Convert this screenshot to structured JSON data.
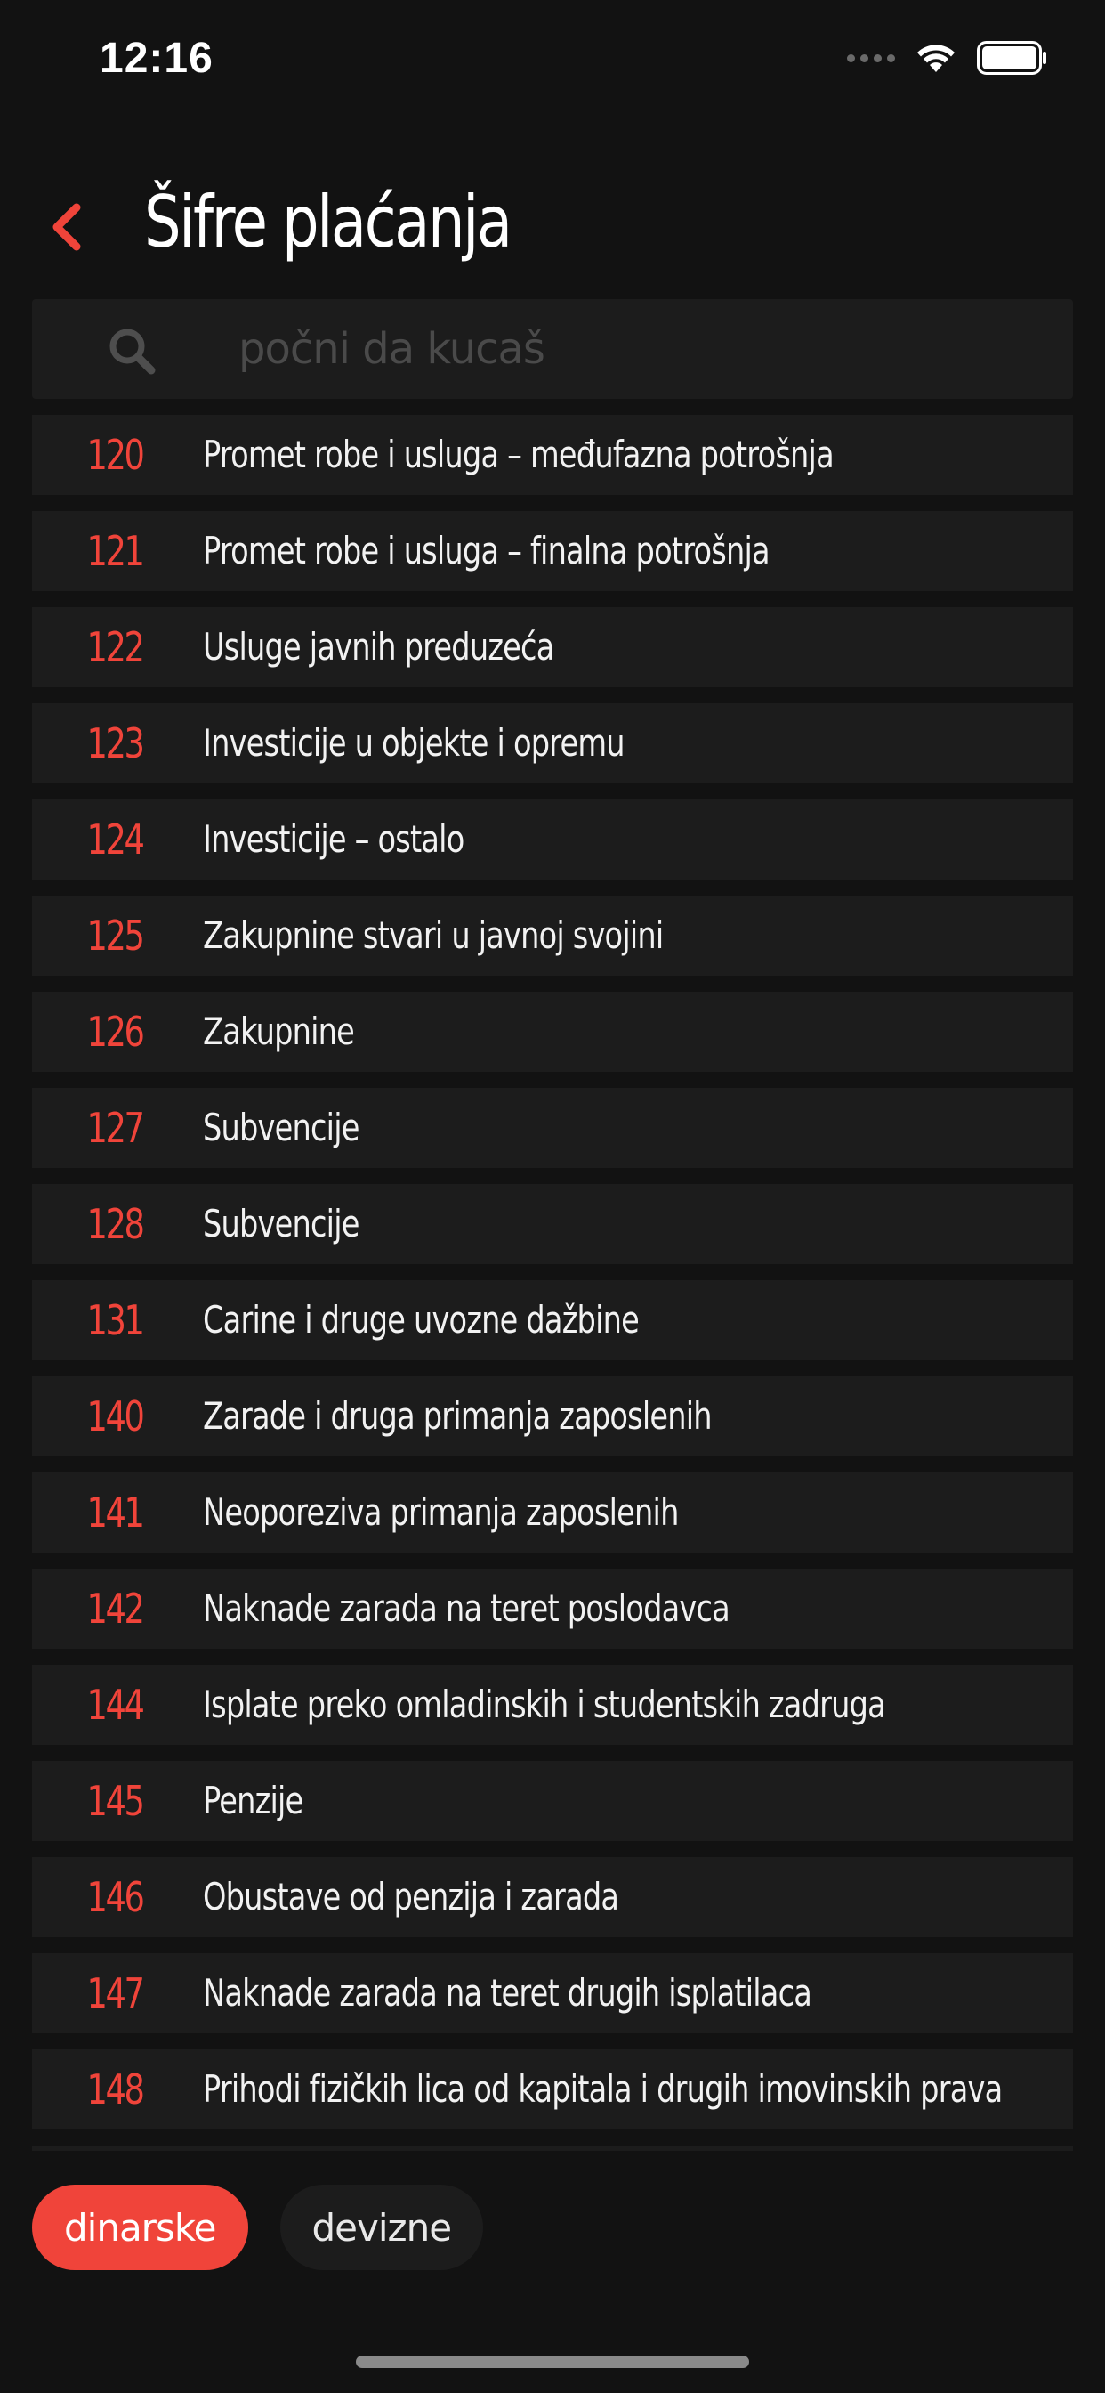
{
  "status_bar": {
    "time": "12:16"
  },
  "header": {
    "title": "Šifre plaćanja"
  },
  "search": {
    "placeholder": "počni da kucaš",
    "value": ""
  },
  "codes": [
    {
      "code": "120",
      "label": "Promet robe i usluga – međufazna potrošnja"
    },
    {
      "code": "121",
      "label": "Promet robe i usluga – finalna potrošnja"
    },
    {
      "code": "122",
      "label": "Usluge javnih preduzeća"
    },
    {
      "code": "123",
      "label": "Investicije u objekte i opremu"
    },
    {
      "code": "124",
      "label": "Investicije – ostalo"
    },
    {
      "code": "125",
      "label": "Zakupnine stvari u javnoj svojini"
    },
    {
      "code": "126",
      "label": "Zakupnine"
    },
    {
      "code": "127",
      "label": "Subvencije"
    },
    {
      "code": "128",
      "label": "Subvencije"
    },
    {
      "code": "131",
      "label": "Carine i druge uvozne dažbine"
    },
    {
      "code": "140",
      "label": "Zarade i druga primanja zaposlenih"
    },
    {
      "code": "141",
      "label": "Neoporeziva primanja zaposlenih"
    },
    {
      "code": "142",
      "label": "Naknade zarada na teret poslodavca"
    },
    {
      "code": "144",
      "label": "Isplate preko omladinskih i studentskih zadruga"
    },
    {
      "code": "145",
      "label": "Penzije"
    },
    {
      "code": "146",
      "label": "Obustave od penzija i zarada"
    },
    {
      "code": "147",
      "label": "Naknade zarada na teret drugih isplatilaca"
    },
    {
      "code": "148",
      "label": "Prihodi fizičkih lica od kapitala i drugih imovinskih prava"
    }
  ],
  "tabs": [
    {
      "label": "dinarske",
      "active": true
    },
    {
      "label": "devizne",
      "active": false
    }
  ],
  "colors": {
    "accent": "#f0443a",
    "background": "#121212",
    "row_background": "#1c1c1c"
  }
}
